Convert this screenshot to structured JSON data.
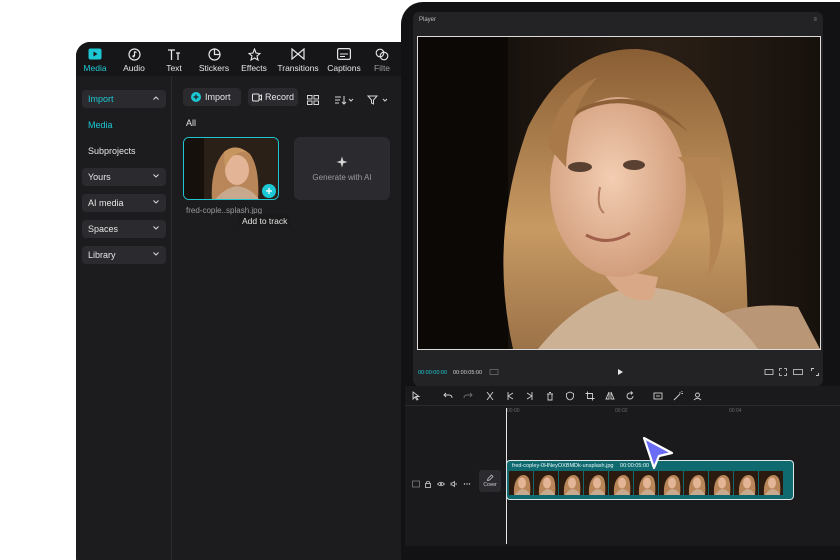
{
  "editor": {
    "tabs": [
      {
        "label": "Media",
        "icon": "media-icon",
        "active": true
      },
      {
        "label": "Audio",
        "icon": "audio-icon",
        "active": false
      },
      {
        "label": "Text",
        "icon": "text-icon",
        "active": false
      },
      {
        "label": "Stickers",
        "icon": "stickers-icon",
        "active": false
      },
      {
        "label": "Effects",
        "icon": "effects-icon",
        "active": false
      },
      {
        "label": "Transitions",
        "icon": "transitions-icon",
        "active": false
      },
      {
        "label": "Captions",
        "icon": "captions-icon",
        "active": false
      },
      {
        "label": "Filte",
        "icon": "filters-icon",
        "active": false
      }
    ],
    "sidebar": {
      "import_label": "Import",
      "media_label": "Media",
      "subprojects_label": "Subprojects",
      "yours_label": "Yours",
      "ai_media_label": "AI media",
      "spaces_label": "Spaces",
      "library_label": "Library"
    },
    "toolbar": {
      "import_button": "Import",
      "record_button": "Record"
    },
    "filter_label": "All",
    "media_item_name": "fred-cople..splash.jpg",
    "generate_label": "Generate with AI",
    "tooltip": "Add to track"
  },
  "player": {
    "title": "Player",
    "current_time": "00:00:00:00",
    "total_time": "00:00:05:00"
  },
  "timeline": {
    "ruler_marks": [
      "00:00",
      "00:02",
      "00:04"
    ],
    "clip_label": "fred-copley-0HNeyOXBMDk-unsplash.jpg",
    "clip_duration": "00:00:05:00",
    "cover_label": "Cover"
  },
  "colors": {
    "accent": "#1cc8d4",
    "panel": "#1c1c1f",
    "device": "#121214",
    "clip": "#0f6a70"
  }
}
